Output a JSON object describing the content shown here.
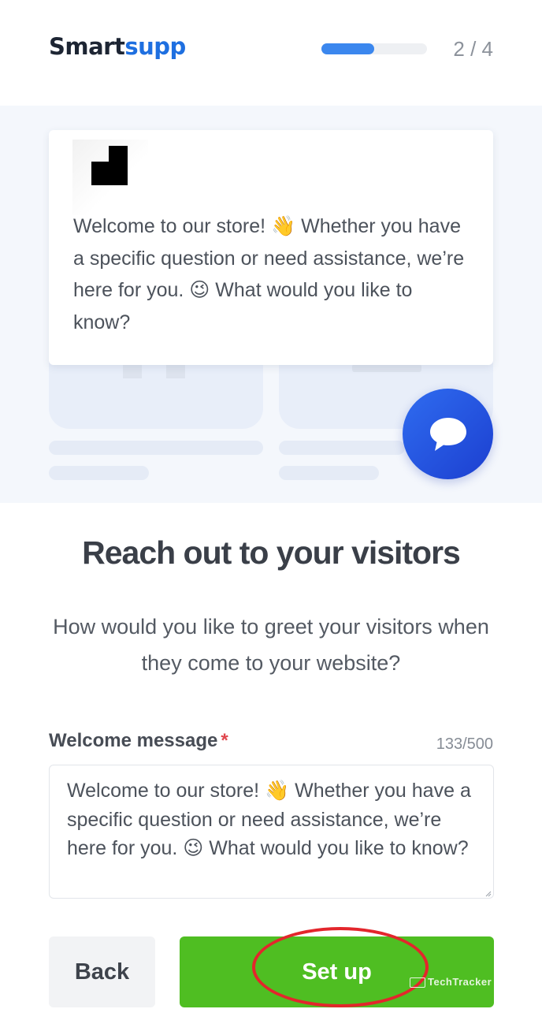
{
  "header": {
    "logo_part1": "Smart",
    "logo_part2": "supp",
    "step_indicator": "2 / 4",
    "progress_fraction": 0.5
  },
  "preview": {
    "bubble_message": "Welcome to our store! 👋 Whether you have a specific question or need assistance, we’re here for you. 😉 What would you like to know?",
    "chat_icon": "chat-bubble-icon"
  },
  "main": {
    "headline": "Reach out to your visitors",
    "subtext": "How would you like to greet your visitors when they come to your website?"
  },
  "form": {
    "label": "Welcome message",
    "required_mark": "*",
    "counter": "133/500",
    "value": "Welcome to our store! 👋 Whether you have a specific question or need assistance, we’re here for you. 😉 What would you like to know?"
  },
  "actions": {
    "back_label": "Back",
    "setup_label": "Set up"
  },
  "watermark": "TechTracker",
  "colors": {
    "brand_dark": "#1d2533",
    "brand_blue": "#1e6fe0",
    "progress": "#3b87ee",
    "primary_green": "#4fbe22",
    "chat_blue": "#1c3fd0",
    "required_red": "#e0464d",
    "annotation_red": "#e3262c"
  }
}
